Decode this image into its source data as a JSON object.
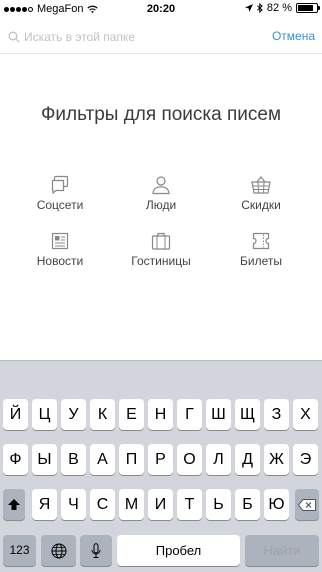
{
  "status_bar": {
    "carrier": "MegaFon",
    "time": "20:20",
    "battery_text": "82 %",
    "battery_level": 0.82,
    "signal_bars_filled": 4,
    "signal_bars_total": 5,
    "icons": [
      "wifi-icon",
      "location-arrow-icon",
      "bluetooth-icon",
      "battery-icon"
    ]
  },
  "search": {
    "placeholder": "Искать в этой папке",
    "value": "",
    "cancel_label": "Отмена",
    "accent_color": "#3a8fd6"
  },
  "title": "Фильтры для поиска писем",
  "filters": [
    {
      "label": "Соцсети",
      "icon": "chat-bubbles-icon"
    },
    {
      "label": "Люди",
      "icon": "person-icon"
    },
    {
      "label": "Скидки",
      "icon": "basket-icon"
    },
    {
      "label": "Новости",
      "icon": "newspaper-icon"
    },
    {
      "label": "Гостиницы",
      "icon": "suitcase-icon"
    },
    {
      "label": "Билеты",
      "icon": "ticket-icon"
    }
  ],
  "keyboard": {
    "row1": [
      "Й",
      "Ц",
      "У",
      "К",
      "Е",
      "Н",
      "Г",
      "Ш",
      "Щ",
      "З",
      "Х"
    ],
    "row2": [
      "Ф",
      "Ы",
      "В",
      "А",
      "П",
      "Р",
      "О",
      "Л",
      "Д",
      "Ж",
      "Э"
    ],
    "row3": [
      "Я",
      "Ч",
      "С",
      "М",
      "И",
      "Т",
      "Ь",
      "Б",
      "Ю"
    ],
    "numbers_label": "123",
    "space_label": "Пробел",
    "search_label": "Найти"
  }
}
